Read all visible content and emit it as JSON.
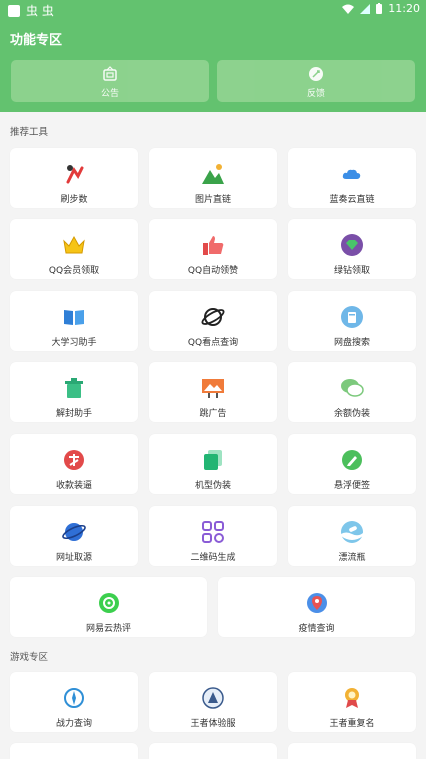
{
  "status": {
    "left_text": "虫 虫",
    "time": "11:20"
  },
  "header": {
    "title": "功能专区",
    "buttons": [
      {
        "label": "公告",
        "icon": "notice-icon"
      },
      {
        "label": "反馈",
        "icon": "feedback-icon"
      }
    ]
  },
  "sections": [
    {
      "title": "推荐工具"
    },
    {
      "title": "游戏专区"
    }
  ],
  "tools": [
    {
      "label": "刷步数",
      "icon": "step-icon"
    },
    {
      "label": "图片直链",
      "icon": "image-link-icon"
    },
    {
      "label": "蓝奏云直链",
      "icon": "cloud-icon"
    },
    {
      "label": "QQ会员领取",
      "icon": "crown-icon"
    },
    {
      "label": "QQ自动领赞",
      "icon": "thumbs-up-icon"
    },
    {
      "label": "绿钻领取",
      "icon": "diamond-icon"
    },
    {
      "label": "大学习助手",
      "icon": "book-icon"
    },
    {
      "label": "QQ看点查询",
      "icon": "planet-icon"
    },
    {
      "label": "网盘搜索",
      "icon": "disk-icon"
    },
    {
      "label": "解封助手",
      "icon": "trash-icon"
    },
    {
      "label": "跳广告",
      "icon": "billboard-icon"
    },
    {
      "label": "余额伪装",
      "icon": "chat-icon"
    },
    {
      "label": "收款装逼",
      "icon": "alipay-icon"
    },
    {
      "label": "机型伪装",
      "icon": "device-icon"
    },
    {
      "label": "悬浮便签",
      "icon": "pen-icon"
    },
    {
      "label": "网址取源",
      "icon": "globe-icon"
    },
    {
      "label": "二维码生成",
      "icon": "qrcode-icon"
    },
    {
      "label": "漂流瓶",
      "icon": "bottle-icon"
    },
    {
      "label": "网易云热评",
      "icon": "music-icon"
    },
    {
      "label": "疫情查询",
      "icon": "map-pin-icon"
    }
  ],
  "games": [
    {
      "label": "战力查询",
      "icon": "compass-icon"
    },
    {
      "label": "王者体验服",
      "icon": "warrior-icon"
    },
    {
      "label": "王者重复名",
      "icon": "medal-icon"
    }
  ]
}
